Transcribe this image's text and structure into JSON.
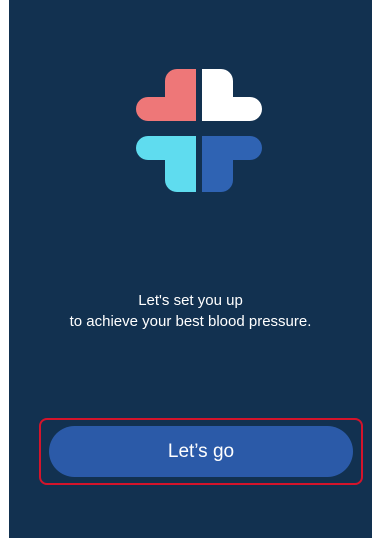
{
  "app": {
    "logo_icon": "heart-clover-logo-icon",
    "logo_colors": {
      "top_left": "#ee7778",
      "top_right": "#ffffff",
      "bottom_left": "#5fdcef",
      "bottom_right": "#2f63b3"
    },
    "background_color": "#123150"
  },
  "onboarding": {
    "subtitle_line1": "Let's set you up",
    "subtitle_line2": "to achieve your best blood pressure."
  },
  "cta": {
    "label": "Let’s go",
    "button_color": "#2b5aa8",
    "highlight_color": "#d4142b"
  }
}
